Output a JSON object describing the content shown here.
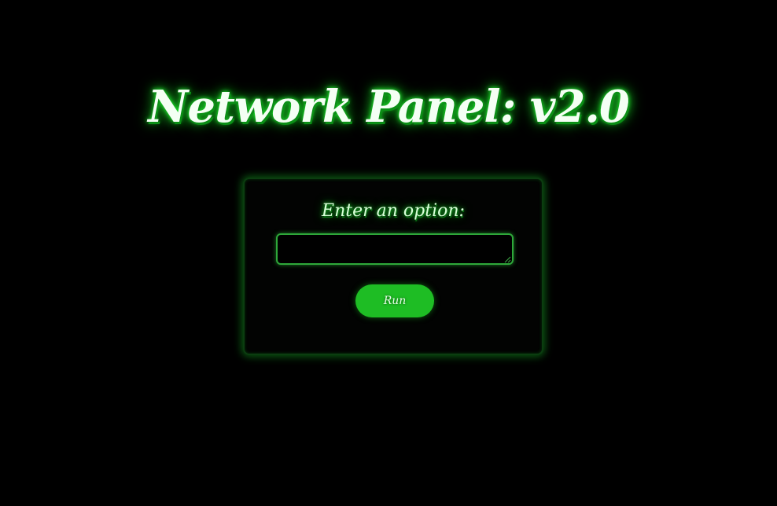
{
  "header": {
    "title": "Network Panel: v2.0"
  },
  "form": {
    "prompt": "Enter an option:",
    "input_value": "",
    "run_label": "Run"
  },
  "colors": {
    "background": "#000000",
    "accent_green": "#1ebd24",
    "glow_green": "#22ff33",
    "text_light": "#f4fff4"
  },
  "icons": {
    "resize_grip": "resize-grip-icon"
  }
}
